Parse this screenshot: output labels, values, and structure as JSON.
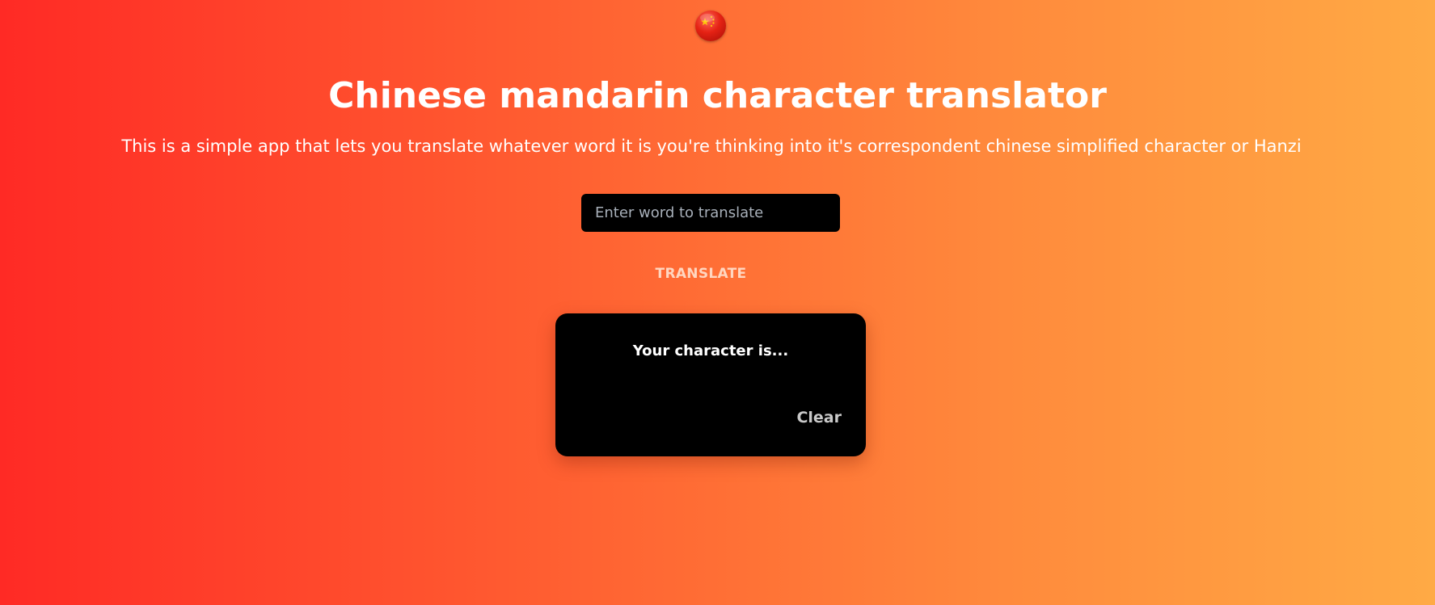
{
  "header": {
    "flag_icon": "china-flag-icon",
    "title": "Chinese mandarin character translator",
    "subtitle": "This is a simple app that lets you translate whatever word it is you're thinking into it's correspondent chinese simplified character or Hanzi"
  },
  "form": {
    "input_value": "",
    "input_placeholder": "Enter word to translate",
    "translate_label": "TRANSLATE"
  },
  "result": {
    "heading": "Your character is...",
    "character": "",
    "clear_label": "Clear"
  },
  "colors": {
    "gradient_start": "#ff2a25",
    "gradient_end": "#ffaa45",
    "card_background": "#000000",
    "text_primary": "#ffffff"
  }
}
